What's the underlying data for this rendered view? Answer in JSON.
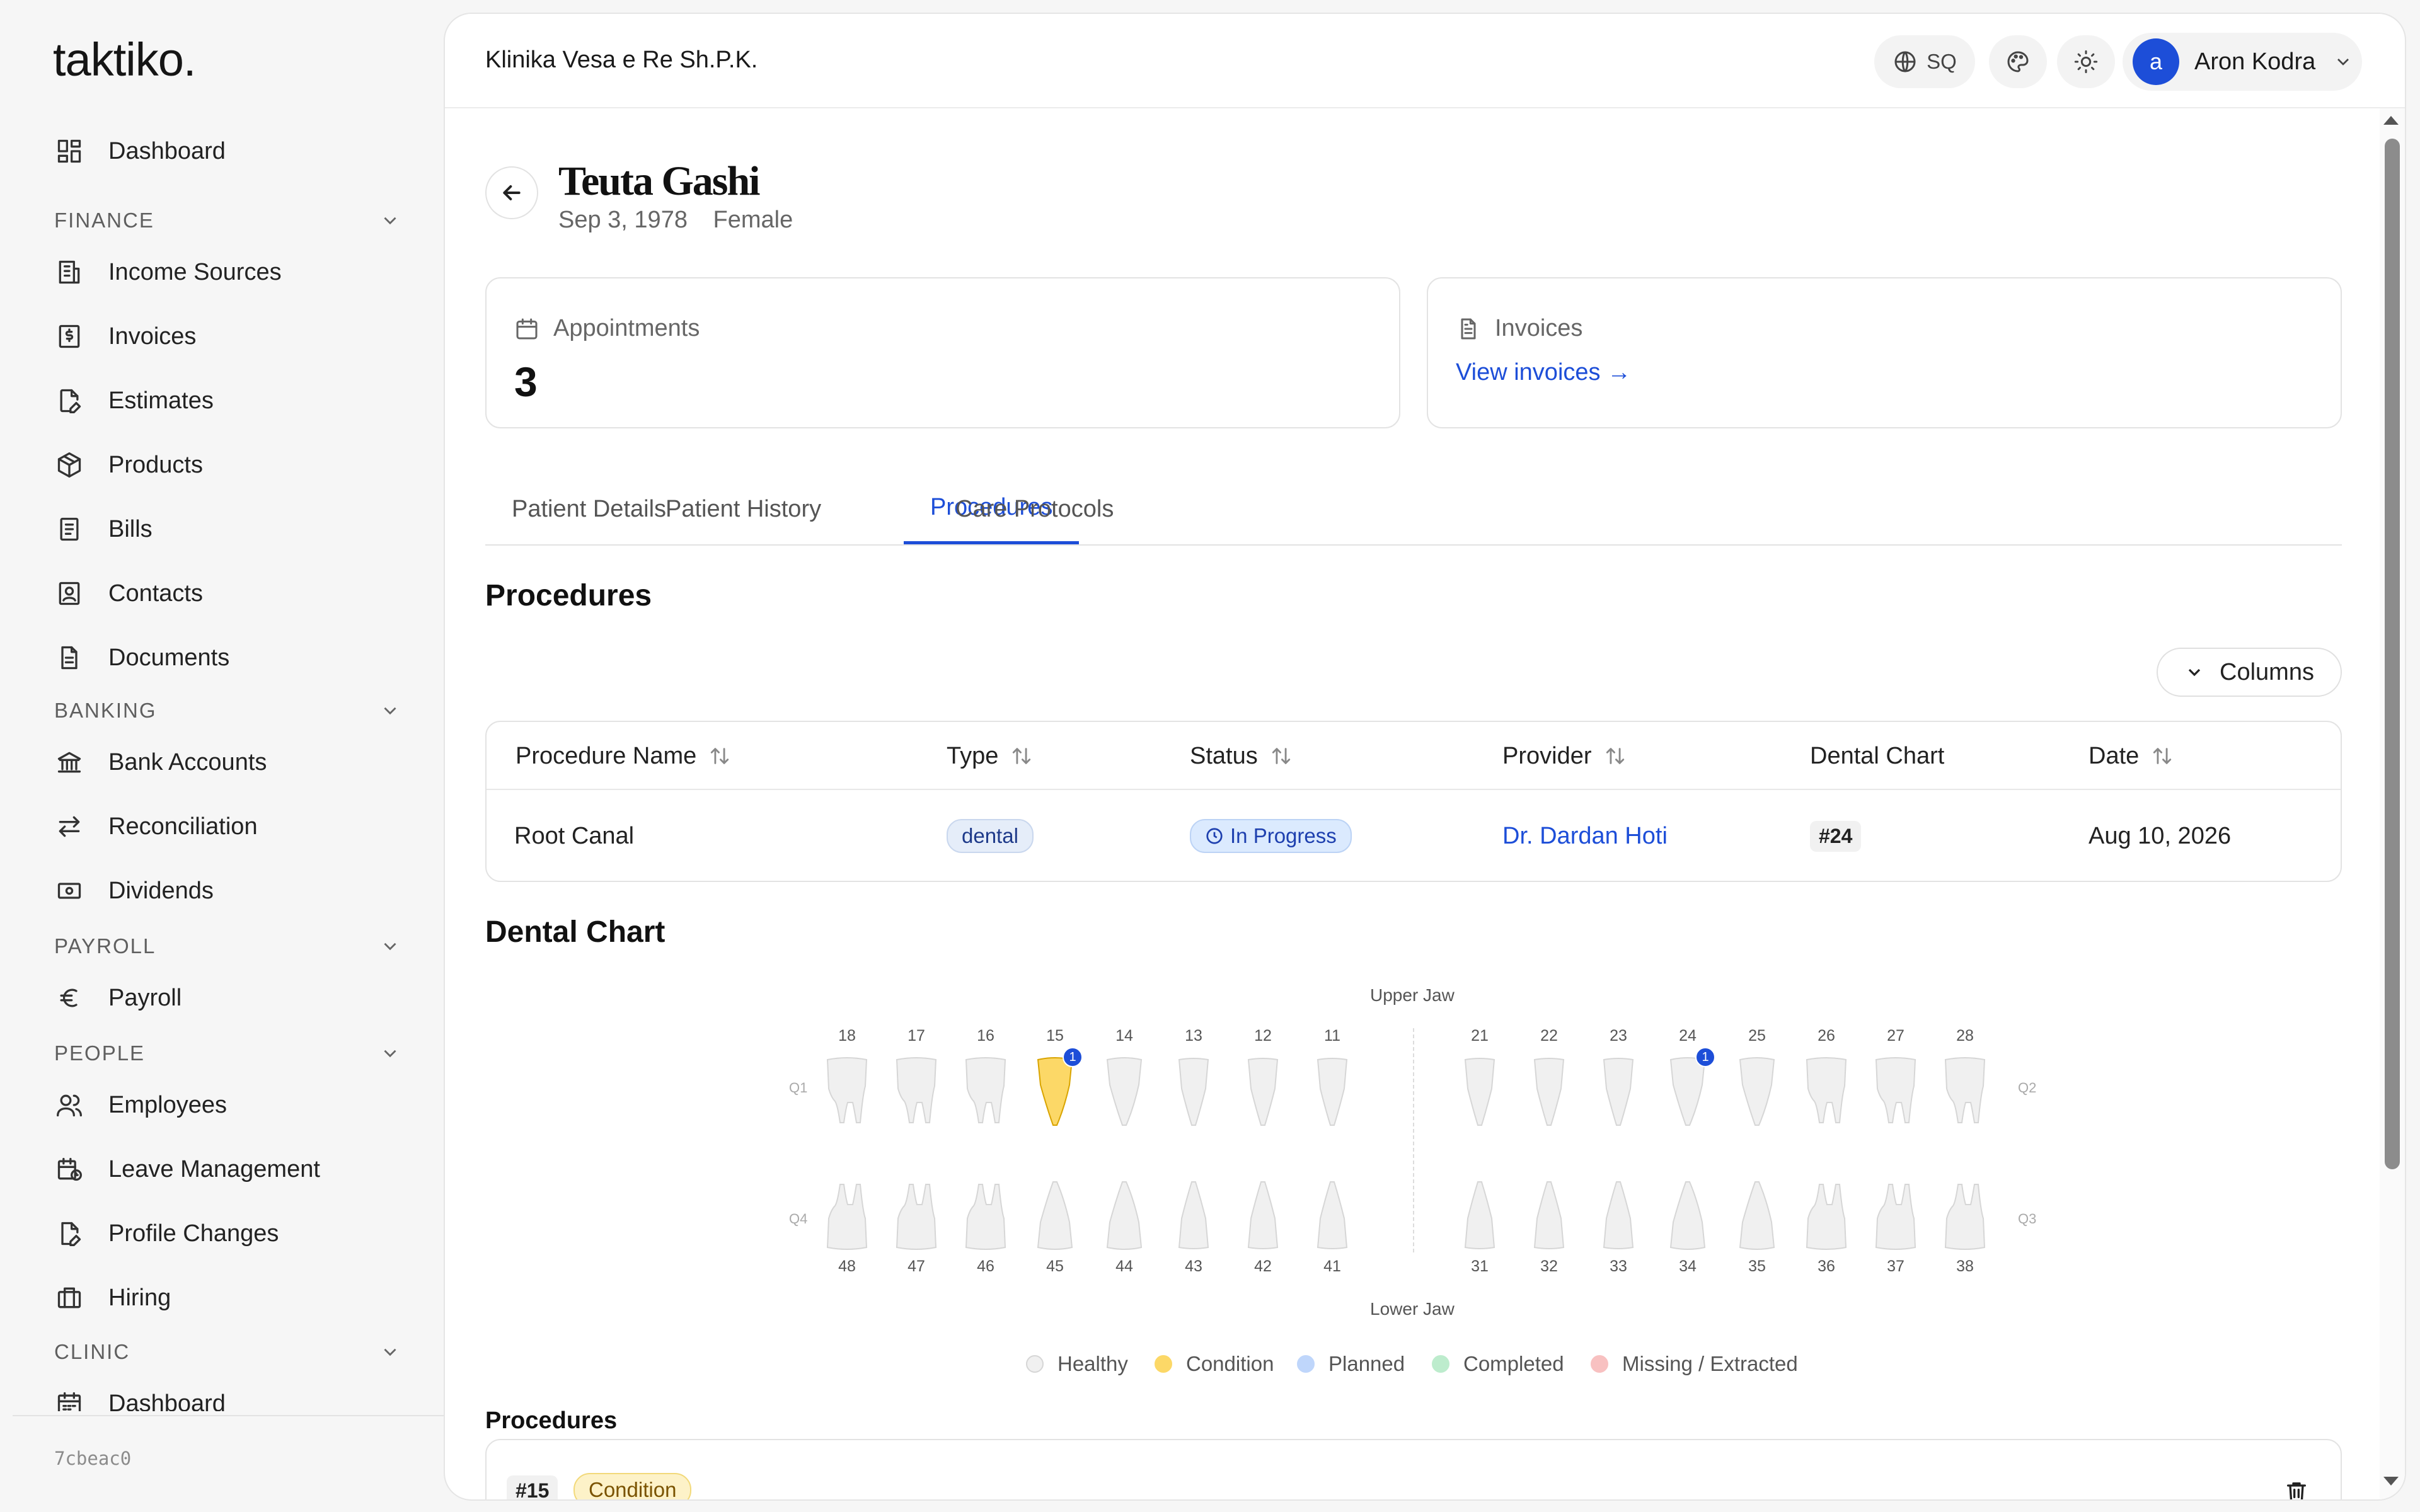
{
  "app": {
    "logo": "taktiko.",
    "version": "7cbeac0"
  },
  "sidebar": {
    "dashboard": "Dashboard",
    "sections": {
      "finance": "FINANCE",
      "banking": "BANKING",
      "payroll": "PAYROLL",
      "people": "PEOPLE",
      "clinic": "CLINIC"
    },
    "finance_items": [
      "Income Sources",
      "Invoices",
      "Estimates",
      "Products",
      "Bills",
      "Contacts",
      "Documents"
    ],
    "banking_items": [
      "Bank Accounts",
      "Reconciliation",
      "Dividends"
    ],
    "payroll_items": [
      "Payroll"
    ],
    "people_items": [
      "Employees",
      "Leave Management",
      "Profile Changes",
      "Hiring"
    ],
    "clinic_items": [
      "Dashboard"
    ]
  },
  "topbar": {
    "company": "Klinika Vesa e Re Sh.P.K.",
    "language": "SQ",
    "user_initial": "a",
    "user_name": "Aron Kodra"
  },
  "patient": {
    "name": "Teuta Gashi",
    "dob": "Sep 3, 1978",
    "gender": "Female"
  },
  "stats": {
    "appointments_label": "Appointments",
    "appointments_value": "3",
    "invoices_label": "Invoices",
    "invoices_link": "View invoices →"
  },
  "tabs": [
    "Patient Details",
    "Patient History",
    "Procedures",
    "Care Protocols"
  ],
  "active_tab": "Procedures",
  "procedures": {
    "title": "Procedures",
    "columns_button": "Columns",
    "headers": [
      "Procedure Name",
      "Type",
      "Status",
      "Provider",
      "Dental Chart",
      "Date"
    ],
    "rows": [
      {
        "name": "Root Canal",
        "type": "dental",
        "status": "In Progress",
        "provider": "Dr. Dardan Hoti",
        "tooth": "#24",
        "date": "Aug 10, 2026"
      }
    ]
  },
  "dental_chart": {
    "title": "Dental Chart",
    "upper_jaw": "Upper Jaw",
    "lower_jaw": "Lower Jaw",
    "quadrants": [
      "Q1",
      "Q2",
      "Q3",
      "Q4"
    ],
    "upper_teeth": [
      "18",
      "17",
      "16",
      "15",
      "14",
      "13",
      "12",
      "11",
      "21",
      "22",
      "23",
      "24",
      "25",
      "26",
      "27",
      "28"
    ],
    "lower_teeth": [
      "48",
      "47",
      "46",
      "45",
      "44",
      "43",
      "42",
      "41",
      "31",
      "32",
      "33",
      "34",
      "35",
      "36",
      "37",
      "38"
    ],
    "markers": [
      {
        "tooth": "15",
        "count": "1",
        "state": "Condition"
      },
      {
        "tooth": "24",
        "count": "1",
        "state": "Planned"
      }
    ],
    "legend": [
      {
        "label": "Healthy",
        "color": "#f0f0f0",
        "border": "#d6d6d6"
      },
      {
        "label": "Condition",
        "color": "#fcd867",
        "border": "#fcd867"
      },
      {
        "label": "Planned",
        "color": "#bfd6fb",
        "border": "#bfd6fb"
      },
      {
        "label": "Completed",
        "color": "#bdeccd",
        "border": "#bdeccd"
      },
      {
        "label": "Missing / Extracted",
        "color": "#f8c1c1",
        "border": "#f8c1c1"
      }
    ]
  },
  "procedure_list": {
    "title": "Procedures",
    "items": [
      {
        "tooth": "#15",
        "state": "Condition"
      }
    ]
  }
}
